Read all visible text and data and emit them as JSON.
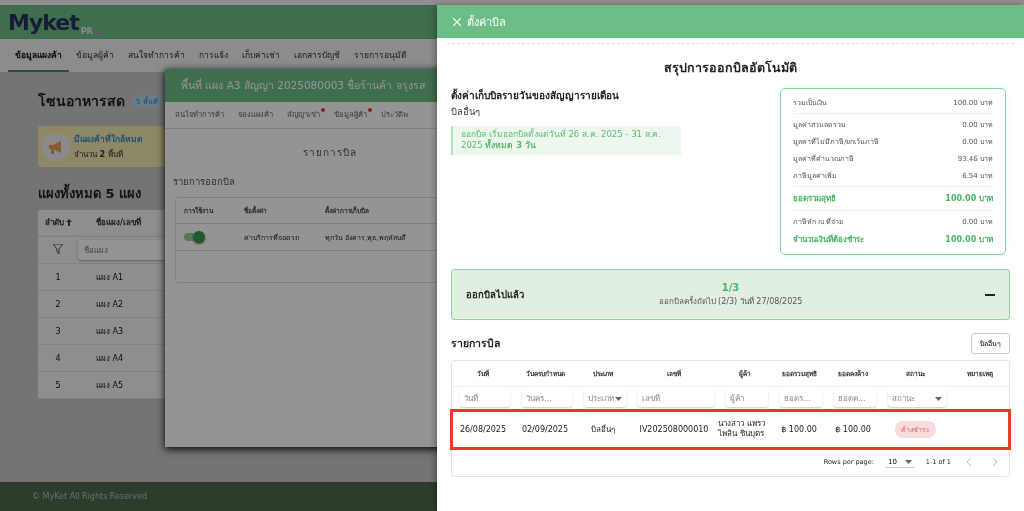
{
  "page": {
    "logo": {
      "name": "Myket",
      "sub": "PR"
    },
    "nav": [
      {
        "label": "ข้อมูลแผงค้า",
        "selected": true
      },
      {
        "label": "ข้อมูลผู้ค้า",
        "selected": false
      },
      {
        "label": "สนใจทำการค้า",
        "selected": false
      },
      {
        "label": "การแจ้ง",
        "selected": false
      },
      {
        "label": "เก็บค่าเช่า",
        "selected": false
      },
      {
        "label": "เอกสารบัญชี",
        "selected": false
      },
      {
        "label": "รายการอนุมัติ",
        "selected": false
      }
    ],
    "zone": {
      "title": "โซนอาหารสด",
      "badge": "5 พื้นที่"
    },
    "alert": {
      "title": "มีแผงค้าที่ใกล้หมด",
      "text": "จำนวน **2** พื้นที่"
    },
    "stalls_title": "แผงทั้งหมด 5 แผง",
    "stalls_table": {
      "columns": [
        {
          "label": "ลำดับ",
          "sorted": true
        },
        {
          "label": "ชื่อแผง/เลขที่",
          "sorted": false
        }
      ],
      "filter_placeholder": "ชื่อแผง",
      "rows": [
        [
          "1",
          "แผง A1"
        ],
        [
          "2",
          "แผง A2"
        ],
        [
          "3",
          "แผง A3"
        ],
        [
          "4",
          "แผง A4"
        ],
        [
          "5",
          "แผง A5"
        ]
      ]
    },
    "footer": "© MyKet All Rights Reserved"
  },
  "modal": {
    "title": "พื้นที่ แผง A3 สัญญา 2025080003 ชื่อร้านค้า จรุงรส",
    "tabs": [
      {
        "label": "สนใจทำการค้า",
        "selected": false,
        "alert": false
      },
      {
        "label": "จองแผงค้า",
        "selected": false,
        "alert": false
      },
      {
        "label": "สัญญาเช่า",
        "selected": false,
        "alert": true
      },
      {
        "label": "ข้อมูลผู้ค้า",
        "selected": false,
        "alert": true
      },
      {
        "label": "ประวัติพ",
        "selected": false,
        "alert": false
      }
    ],
    "heading": "รายการบิล",
    "section": "รายการออกบิล",
    "billing_table": {
      "columns": [
        "การใช้งาน",
        "ชื่อตั้งค่า",
        "ตั้งค่าการเก็บบิล"
      ],
      "rows": [
        {
          "enabled": true,
          "name": "ค่าบริการที่จอดรถ",
          "schedule": "ทุกวัน อังคาร,พุธ,พฤหัสบดี"
        }
      ]
    }
  },
  "drawer": {
    "title": "ตั้งค่าบิล",
    "heading": "สรุปการออกบิลอัตโนมัติ",
    "setting_title": "ตั้งค่าเก็บบิลรายวันของสัญญารายเดือน",
    "setting_type": "บิลอื่นๆ",
    "note": "ออกบิล เริ่มออกบิลตั้งแต่วันที่ 26 ส.ค. 2025 - 31 ส.ค. 2025 **ทั้งหมด 3 วัน**",
    "summary": [
      {
        "label": "รวมเป็นเงิน",
        "value": "100.00 บาท",
        "kind": "normal",
        "divider_after": true
      },
      {
        "label": "มูลค่าส่วนลดรวม",
        "value": "0.00 บาท",
        "kind": "normal",
        "divider_after": false
      },
      {
        "label": "มูลค่าที่ไม่มีภาษี/ยกเว้นภาษี",
        "value": "0.00 บาท",
        "kind": "normal",
        "divider_after": false
      },
      {
        "label": "มูลค่าที่คำนวณภาษี",
        "value": "93.46 บาท",
        "kind": "normal",
        "divider_after": false
      },
      {
        "label": "ภาษีมูลค่าเพิ่ม",
        "value": "6.54 บาท",
        "kind": "normal",
        "divider_after": true
      },
      {
        "label": "ยอดรวมสุทธิ",
        "value": "100.00 บาท",
        "kind": "total",
        "divider_after": true
      },
      {
        "label": "ภาษีหัก ณ ที่จ่าย",
        "value": "0.00 บาท",
        "kind": "normal",
        "divider_after": false
      },
      {
        "label": "จำนวนเงินที่ต้องชำระ",
        "value": "100.00 บาท",
        "kind": "total",
        "divider_after": false
      }
    ],
    "progress": {
      "label": "ออกบิลไปแล้ว",
      "count": "1/3",
      "next": "ออกบิลครั้งถัดไป (2/3) วันที่ 27/08/2025",
      "expanded": true
    },
    "bills": {
      "title": "รายการบิล",
      "button": "บิลอื่นๆ",
      "columns": [
        "วันที่",
        "วันครบกำหนด",
        "ประเภท",
        "เลขที่",
        "ผู้ค้า",
        "ยอดรวมสุทธิ",
        "ยอดคงค้าง",
        "สถานะ",
        "หมายเหตุ"
      ],
      "filters": [
        {
          "placeholder": "วันที่",
          "kind": "text"
        },
        {
          "placeholder": "วันคร…",
          "kind": "text"
        },
        {
          "placeholder": "ประเภท",
          "kind": "select"
        },
        {
          "placeholder": "เลขที่",
          "kind": "text"
        },
        {
          "placeholder": "ผู้ค้า",
          "kind": "text"
        },
        {
          "placeholder": "ยอดร…",
          "kind": "text"
        },
        {
          "placeholder": "ยอดค…",
          "kind": "text"
        },
        {
          "placeholder": "สถานะ",
          "kind": "select"
        }
      ],
      "rows": [
        {
          "highlighted": true,
          "date": "26/08/2025",
          "due": "02/09/2025",
          "type": "บิลอื่นๆ",
          "number": "IV202508000010",
          "vendor": "นางสาว แพรวไพลิน ชินบุตร",
          "total": "฿ 100.00",
          "balance": "฿ 100.00",
          "status": {
            "label": "ค้างชำระ",
            "kind": "unpaid"
          }
        }
      ],
      "pagination": {
        "rows_label": "Rows per page:",
        "rows_value": "10",
        "range": "1-1 of 1"
      }
    }
  }
}
